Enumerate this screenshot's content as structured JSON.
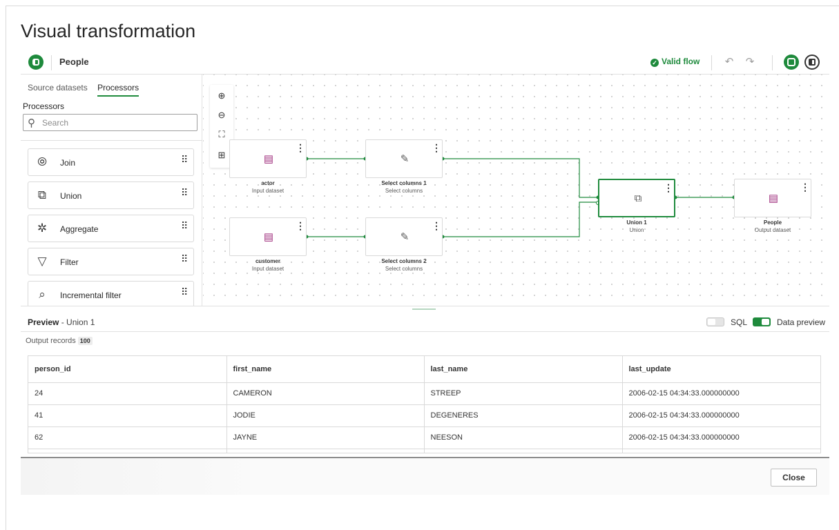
{
  "page_title": "Visual transformation",
  "toolbar": {
    "flow_name": "People",
    "status": "Valid flow",
    "undo_icon": "↶",
    "redo_icon": "↷"
  },
  "sidebar": {
    "tabs": [
      "Source datasets",
      "Processors"
    ],
    "active_tab": "Processors",
    "section_label": "Processors",
    "search_placeholder": "Search",
    "processors": [
      {
        "label": "Join",
        "icon": "join-icon",
        "glyph": "⦾"
      },
      {
        "label": "Union",
        "icon": "union-icon",
        "glyph": "⧉"
      },
      {
        "label": "Aggregate",
        "icon": "aggregate-icon",
        "glyph": "✲"
      },
      {
        "label": "Filter",
        "icon": "filter-icon",
        "glyph": "▽"
      },
      {
        "label": "Incremental filter",
        "icon": "incremental-filter-icon",
        "glyph": "⌕"
      }
    ]
  },
  "canvas": {
    "zoom_controls": [
      "zoom-in",
      "zoom-out",
      "fit-to-screen",
      "auto-layout"
    ],
    "nodes": [
      {
        "id": "actor",
        "title": "actor",
        "subtitle": "Input dataset",
        "type": "dataset"
      },
      {
        "id": "select1",
        "title": "Select columns 1",
        "subtitle": "Select columns",
        "type": "select"
      },
      {
        "id": "customer",
        "title": "customer",
        "subtitle": "Input dataset",
        "type": "dataset"
      },
      {
        "id": "select2",
        "title": "Select columns 2",
        "subtitle": "Select columns",
        "type": "select"
      },
      {
        "id": "union1",
        "title": "Union 1",
        "subtitle": "Union",
        "type": "union"
      },
      {
        "id": "people",
        "title": "People",
        "subtitle": "Output dataset",
        "type": "dataset"
      }
    ]
  },
  "preview": {
    "label": "Preview",
    "separator": " - ",
    "target": "Union 1",
    "sql_label": "SQL",
    "data_preview_label": "Data preview",
    "output_records_label": "Output records",
    "output_records_count": "100",
    "columns": [
      "person_id",
      "first_name",
      "last_name",
      "last_update"
    ],
    "rows": [
      [
        "24",
        "CAMERON",
        "STREEP",
        "2006-02-15 04:34:33.000000000"
      ],
      [
        "41",
        "JODIE",
        "DEGENERES",
        "2006-02-15 04:34:33.000000000"
      ],
      [
        "62",
        "JAYNE",
        "NEESON",
        "2006-02-15 04:34:33.000000000"
      ]
    ]
  },
  "footer": {
    "close_label": "Close"
  },
  "colors": {
    "accent": "#1e8a3c",
    "dataset_icon": "#a0307e"
  }
}
